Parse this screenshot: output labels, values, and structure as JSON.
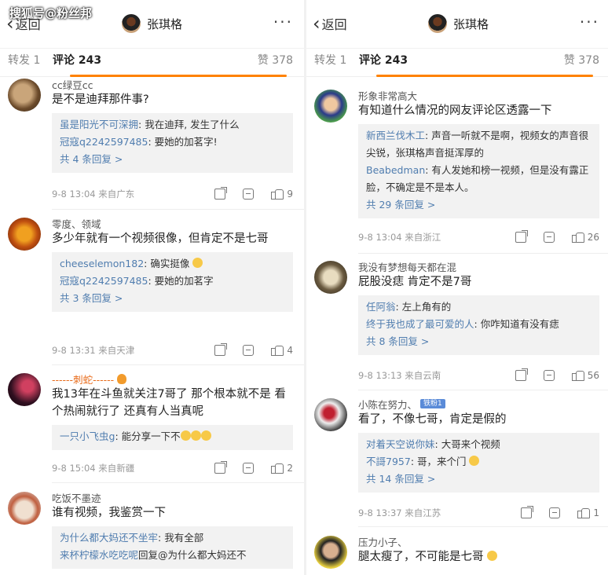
{
  "watermark": "搜狐号@粉丝邦",
  "panels": [
    {
      "back_label": "返回",
      "title": "张琪格",
      "tabs": {
        "repost": "转发 1",
        "comment": "评论 243",
        "likes": "赞 378"
      },
      "comments": [
        {
          "user": "cc绿豆cc",
          "text": "是不是迪拜那件事?",
          "replies": [
            {
              "who": "虽是阳光不可深拥",
              "text": ": 我在迪拜, 发生了什么"
            },
            {
              "who": "冠寇q2242597485",
              "text": ": 要她的加茗字!"
            }
          ],
          "more": "共 4 条回复 >",
          "time": "9-8 13:04",
          "source": "来自广东",
          "likes": "9"
        },
        {
          "user": "零度、领域",
          "text": "多少年就有一个视频很像，但肯定不是七哥",
          "replies": [
            {
              "who": "cheeselemon182",
              "text": ": 确实挺像"
            },
            {
              "who": "冠寇q2242597485",
              "text": ": 要她的加茗字"
            }
          ],
          "more": "共 3 条回复 >",
          "time": "9-8 13:31",
          "source": "来自天津",
          "likes": "4"
        },
        {
          "user": "------刺蛇------",
          "text": "我13年在斗鱼就关注7哥了 那个根本就不是 看个热闹就行了 还真有人当真呢",
          "replies": [
            {
              "who": "一只小飞虫g",
              "text": ": 能分享一下不"
            }
          ],
          "more": "",
          "time": "9-8 15:04",
          "source": "来自新疆",
          "likes": "2"
        },
        {
          "user": "吃饭不墨迹",
          "text": "谁有视频，我鉴赏一下",
          "replies": [
            {
              "who": "为什么都大妈还不坐牢",
              "text": ": 我有全部"
            },
            {
              "who": "来杯柠檬水吃吃呢",
              "text": "回复@为什么都大妈还不"
            }
          ],
          "more": "",
          "time": "",
          "source": "",
          "likes": ""
        }
      ]
    },
    {
      "back_label": "返回",
      "title": "张琪格",
      "tabs": {
        "repost": "转发 1",
        "comment": "评论 243",
        "likes": "赞 378"
      },
      "comments": [
        {
          "user": "形象非常高大",
          "text": "有知道什么情况的网友评论区透露一下",
          "replies": [
            {
              "who": "新西兰伐木工",
              "text": ": 声音一听就不是啊，视频女的声音很尖锐，张琪格声音挺浑厚的"
            },
            {
              "who": "Beabedman",
              "text": ": 有人发她和榜一视频，但是没有露正脸，不确定是不是本人。"
            }
          ],
          "more": "共 29 条回复 >",
          "time": "9-8 13:04",
          "source": "来自浙江",
          "likes": "26"
        },
        {
          "user": "我没有梦想每天都在混",
          "text": "屁股没痣 肯定不是7哥",
          "replies": [
            {
              "who": "任阿翁",
              "text": ": 左上角有的"
            },
            {
              "who": "终于我也成了最可爱的人",
              "text": ": 你咋知道有没有痣"
            }
          ],
          "more": "共 8 条回复 >",
          "time": "9-8 13:13",
          "source": "来自云南",
          "likes": "56"
        },
        {
          "user": "小陈在努力、",
          "badge": "铁粉1",
          "text": "看了，不像七哥，肯定是假的",
          "replies": [
            {
              "who": "对着天空说你妹",
              "text": ": 大哥来个视频"
            },
            {
              "who": "不謌7957",
              "text": ": 哥，来个门"
            }
          ],
          "more": "共 14 条回复 >",
          "time": "9-8 13:37",
          "source": "来自江苏",
          "likes": "1"
        },
        {
          "user": "压力小子、",
          "text": "腿太瘦了，不可能是七哥",
          "replies": [],
          "more": "",
          "time": "",
          "source": "",
          "likes": ""
        }
      ]
    }
  ]
}
